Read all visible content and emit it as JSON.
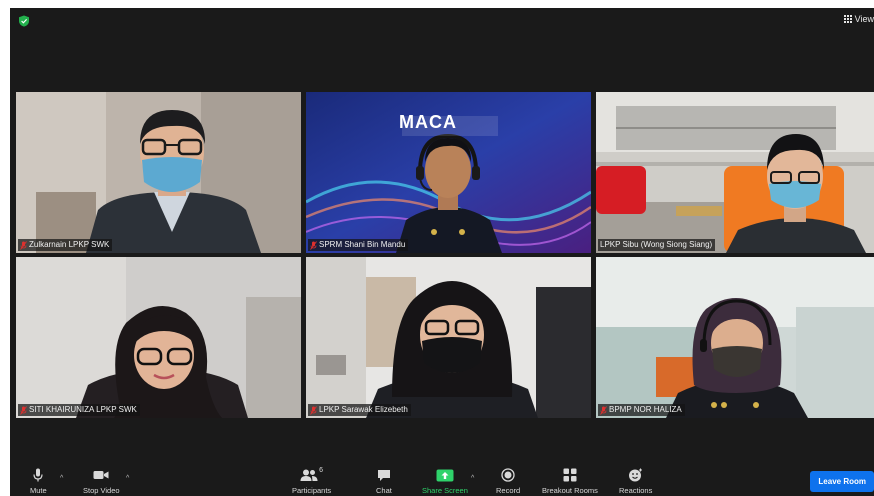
{
  "header": {
    "view_label": "View"
  },
  "participants": [
    {
      "name": "Zulkarnain LPKP SWK",
      "muted": true
    },
    {
      "name": "SPRM Shani Bin Mandu",
      "muted": true,
      "active": true,
      "banner_text": "MACA"
    },
    {
      "name": "LPKP Sibu (Wong Siong Siang)",
      "muted": false
    },
    {
      "name": "SITI KHAIRUNIZA LPKP SWK",
      "muted": true
    },
    {
      "name": "LPKP Sarawak Elizebeth",
      "muted": true
    },
    {
      "name": "BPMP NOR HALIZA",
      "muted": true
    }
  ],
  "toolbar": {
    "mute_label": "Mute",
    "stop_video_label": "Stop Video",
    "participants_label": "Participants",
    "participants_count": "6",
    "chat_label": "Chat",
    "share_label": "Share Screen",
    "record_label": "Record",
    "breakout_label": "Breakout Rooms",
    "reactions_label": "Reactions",
    "leave_label": "Leave Room"
  },
  "colors": {
    "active_border": "#c6e05a",
    "share_green": "#2fd36b",
    "leave_blue": "#0e72ed",
    "muted_red": "#e0302e"
  }
}
